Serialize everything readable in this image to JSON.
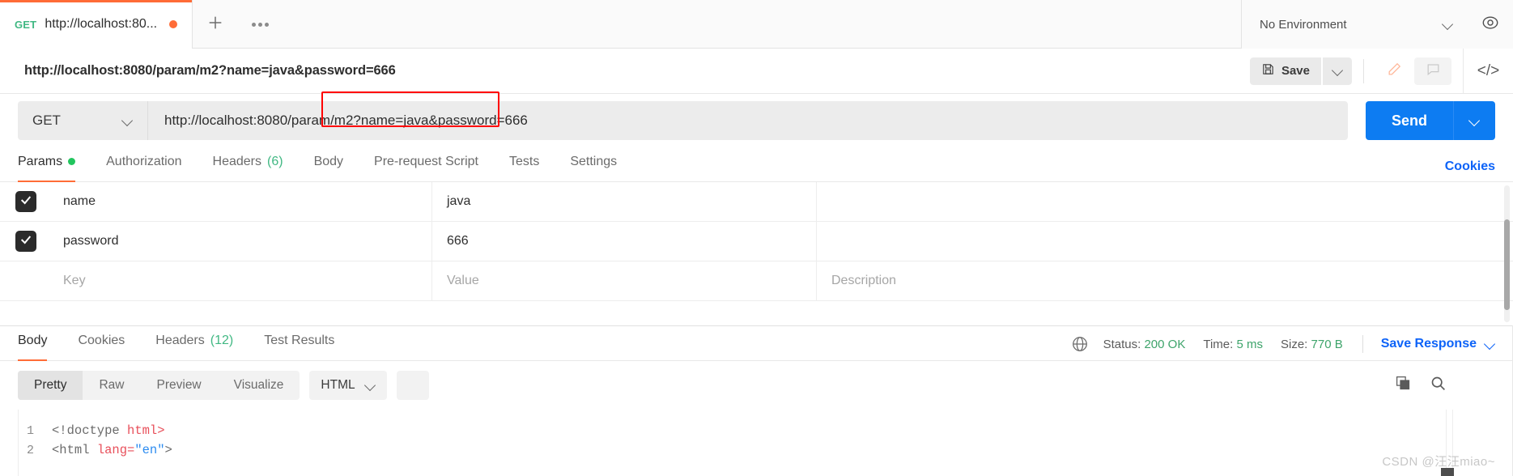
{
  "colors": {
    "accent_orange": "#ff6c37",
    "accent_blue": "#0d7cf2",
    "link_blue": "#0d63f8",
    "green": "#41b883",
    "annotation_red": "#ff0000"
  },
  "tabbar": {
    "request_tab": {
      "method": "GET",
      "title": "http://localhost:80...",
      "unsaved_indicator": "unsaved-dot"
    },
    "new_tab_icon": "plus-icon",
    "more_icon": "ellipsis-icon",
    "environment": {
      "selected": "No Environment",
      "caret_icon": "chevron-down-icon",
      "eye_icon": "eye-icon"
    }
  },
  "title_row": {
    "request_name": "http://localhost:8080/param/m2?name=java&password=666",
    "save_label": "Save",
    "save_icon": "floppy-disk-icon",
    "save_caret_icon": "chevron-down-icon",
    "pencil_icon": "pencil-icon",
    "comment_icon": "comment-icon",
    "code_icon": "code-brackets-icon"
  },
  "url_bar": {
    "method": "GET",
    "method_caret_icon": "chevron-down-icon",
    "url": "http://localhost:8080/param/m2?name=java&password=666",
    "url_prefix": "http://localhost:8080/param/m2",
    "url_query": "?name=java&password=666",
    "annotation": "red-box-around-query-string",
    "send_label": "Send",
    "send_caret_icon": "chevron-down-icon"
  },
  "request_tabs": {
    "items": [
      {
        "label": "Params",
        "badge": "dot",
        "active": true
      },
      {
        "label": "Authorization",
        "badge": "",
        "active": false
      },
      {
        "label": "Headers",
        "badge": "(6)",
        "active": false
      },
      {
        "label": "Body",
        "badge": "",
        "active": false
      },
      {
        "label": "Pre-request Script",
        "badge": "",
        "active": false
      },
      {
        "label": "Tests",
        "badge": "",
        "active": false
      },
      {
        "label": "Settings",
        "badge": "",
        "active": false
      }
    ],
    "cookies_link": "Cookies"
  },
  "params_table": {
    "placeholders": {
      "key": "Key",
      "value": "Value",
      "description": "Description"
    },
    "rows": [
      {
        "checked": true,
        "key": "name",
        "value": "java",
        "description": ""
      },
      {
        "checked": true,
        "key": "password",
        "value": "666",
        "description": ""
      },
      {
        "checked": false,
        "key": "",
        "value": "",
        "description": ""
      }
    ]
  },
  "response": {
    "tabs": [
      {
        "label": "Body",
        "badge": "",
        "active": true
      },
      {
        "label": "Cookies",
        "badge": "",
        "active": false
      },
      {
        "label": "Headers",
        "badge": "(12)",
        "active": false
      },
      {
        "label": "Test Results",
        "badge": "",
        "active": false
      }
    ],
    "globe_icon": "globe-icon",
    "status_label": "Status:",
    "status_value": "200 OK",
    "time_label": "Time:",
    "time_value": "5 ms",
    "size_label": "Size:",
    "size_value": "770 B",
    "save_response_label": "Save Response",
    "save_response_caret_icon": "chevron-down-icon",
    "view_modes": [
      {
        "label": "Pretty",
        "active": true
      },
      {
        "label": "Raw",
        "active": false
      },
      {
        "label": "Preview",
        "active": false
      },
      {
        "label": "Visualize",
        "active": false
      }
    ],
    "format": "HTML",
    "format_caret_icon": "chevron-down-icon",
    "wrap_icon": "word-wrap-icon",
    "copy_icon": "copy-icon",
    "search_icon": "search-icon",
    "code_lines": [
      {
        "num": "1",
        "indent": "",
        "pre": "<!doctype ",
        "tag": "html>",
        "attr": "",
        "str": "",
        "post": ""
      },
      {
        "num": "2",
        "indent": "",
        "pre": "<html ",
        "tag": "",
        "attr": "lang=",
        "str": "\"en\"",
        "post": ">"
      }
    ]
  },
  "watermark": "CSDN @汪汪miao~"
}
